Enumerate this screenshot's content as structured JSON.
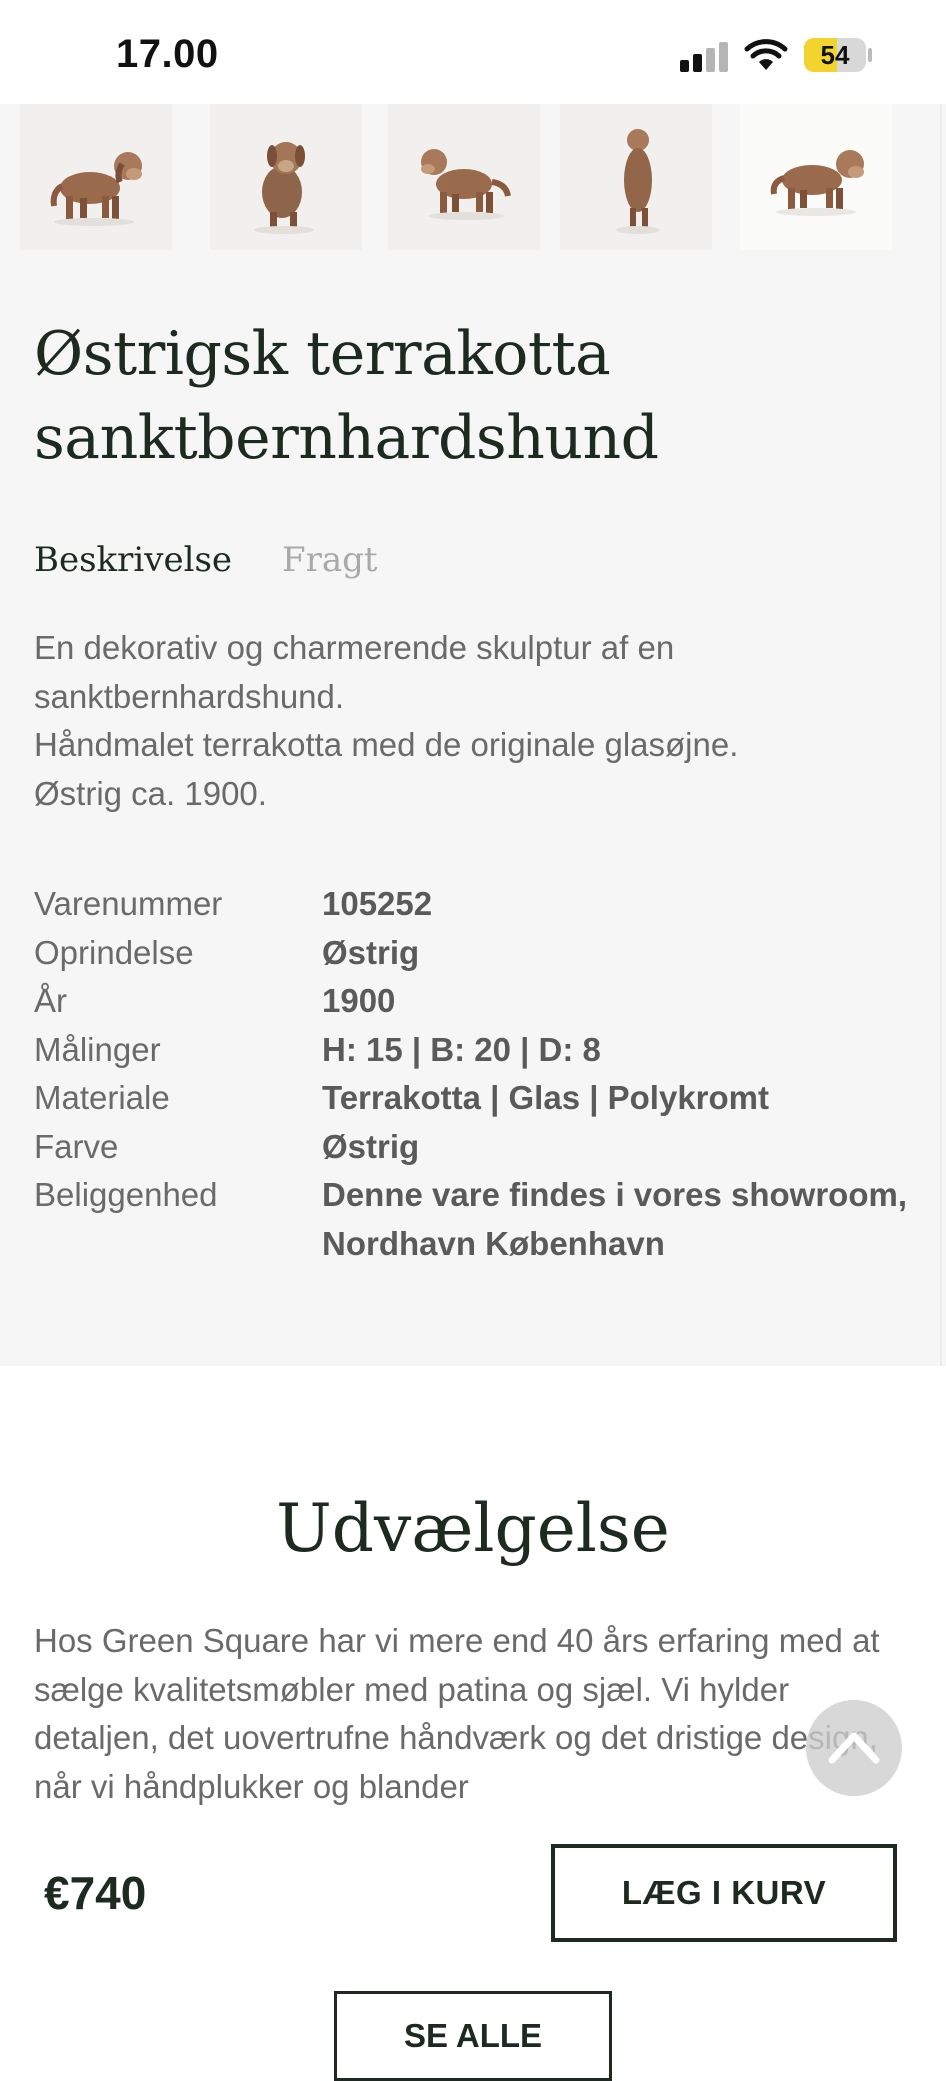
{
  "status_bar": {
    "time": "17.00",
    "battery": "54",
    "battery_level": 0.54
  },
  "product": {
    "title_line1": "Østrigsk terrakotta",
    "title_line2": "sanktbernhardshund",
    "thumbnails": [
      "dog-figurine-side",
      "dog-figurine-front",
      "dog-figurine-walking",
      "dog-figurine-back",
      "dog-figurine-right"
    ],
    "tabs": [
      "Beskrivelse",
      "Fragt"
    ],
    "description": [
      "En dekorativ og charmerende skulptur af en sanktbernhardshund.",
      "Håndmalet terrakotta med de originale glasøjne.",
      "Østrig ca. 1900."
    ],
    "specs": [
      {
        "label": "Varenummer",
        "value": "105252"
      },
      {
        "label": "Oprindelse",
        "value": "Østrig"
      },
      {
        "label": "År",
        "value": "1900"
      },
      {
        "label": "Målinger",
        "value": "H: 15 | B: 20 | D: 8"
      },
      {
        "label": "Materiale",
        "value": "Terrakotta | Glas | Polykromt"
      },
      {
        "label": "Farve",
        "value": "Østrig"
      },
      {
        "label": "Beliggenhed",
        "value": "Denne vare findes i vores showroom, Nordhavn København"
      }
    ]
  },
  "selection": {
    "title": "Udvælgelse",
    "text": "Hos Green Square har vi mere end 40 års erfaring med at sælge kvalitetsmøbler med patina og sjæl. Vi hylder detaljen, det uovertrufne håndværk og det dristige design, når vi håndplukker og blander"
  },
  "purchase": {
    "price": "€740",
    "cart_label": "LÆG I KURV",
    "see_all_label": "SE ALLE"
  },
  "colors": {
    "accent": "#1d2a1f",
    "body_text": "#6a6a6a",
    "panel_bg": "#f6f6f6",
    "battery": "#f3d32e",
    "figurine": "#9a6a4c"
  }
}
